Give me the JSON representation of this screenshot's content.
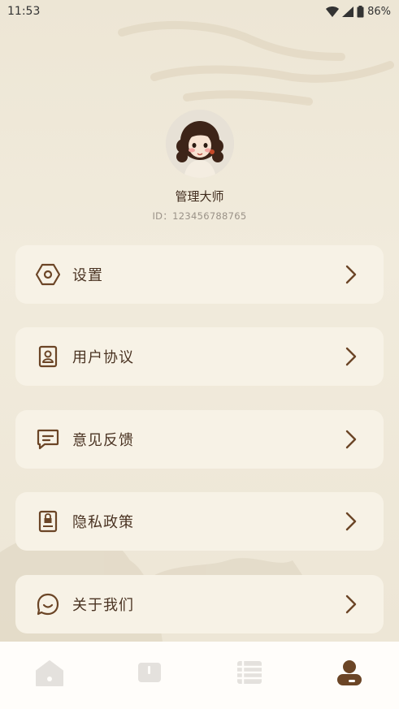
{
  "status": {
    "time": "11:53",
    "battery": "86%"
  },
  "profile": {
    "name": "管理大师",
    "id_text": "ID：123456788765"
  },
  "menu": [
    {
      "label": "设置",
      "icon": "hexagon-settings-icon"
    },
    {
      "label": "用户协议",
      "icon": "user-card-icon"
    },
    {
      "label": "意见反馈",
      "icon": "message-icon"
    },
    {
      "label": "隐私政策",
      "icon": "lock-document-icon"
    },
    {
      "label": "关于我们",
      "icon": "chat-smile-icon"
    }
  ],
  "tabbar": {
    "items": [
      "home-icon",
      "book-icon",
      "list-icon",
      "profile-icon"
    ],
    "active_index": 3
  },
  "colors": {
    "accent": "#6b4526",
    "inactive": "#e4e1dd",
    "card": "#f7f2e6",
    "background": "#efe8d8"
  }
}
